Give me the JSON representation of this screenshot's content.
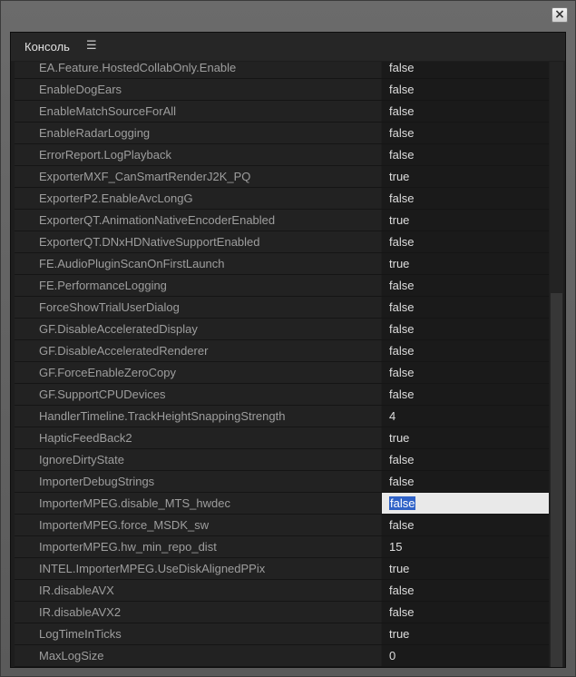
{
  "window": {
    "close_label": "×"
  },
  "panel": {
    "title": "Консоль",
    "menu_icon": "☰"
  },
  "rows": [
    {
      "key": "EA.Feature.HostedCollabOnly.Enable",
      "value": "false"
    },
    {
      "key": "EnableDogEars",
      "value": "false"
    },
    {
      "key": "EnableMatchSourceForAll",
      "value": "false"
    },
    {
      "key": "EnableRadarLogging",
      "value": "false"
    },
    {
      "key": "ErrorReport.LogPlayback",
      "value": "false"
    },
    {
      "key": "ExporterMXF_CanSmartRenderJ2K_PQ",
      "value": "true"
    },
    {
      "key": "ExporterP2.EnableAvcLongG",
      "value": "false"
    },
    {
      "key": "ExporterQT.AnimationNativeEncoderEnabled",
      "value": "true"
    },
    {
      "key": "ExporterQT.DNxHDNativeSupportEnabled",
      "value": "false"
    },
    {
      "key": "FE.AudioPluginScanOnFirstLaunch",
      "value": "true"
    },
    {
      "key": "FE.PerformanceLogging",
      "value": "false"
    },
    {
      "key": "ForceShowTrialUserDialog",
      "value": "false"
    },
    {
      "key": "GF.DisableAcceleratedDisplay",
      "value": "false"
    },
    {
      "key": "GF.DisableAcceleratedRenderer",
      "value": "false"
    },
    {
      "key": "GF.ForceEnableZeroCopy",
      "value": "false"
    },
    {
      "key": "GF.SupportCPUDevices",
      "value": "false"
    },
    {
      "key": "HandlerTimeline.TrackHeightSnappingStrength",
      "value": "4"
    },
    {
      "key": "HapticFeedBack2",
      "value": "true"
    },
    {
      "key": "IgnoreDirtyState",
      "value": "false"
    },
    {
      "key": "ImporterDebugStrings",
      "value": "false"
    },
    {
      "key": "ImporterMPEG.disable_MTS_hwdec",
      "value": "false",
      "selected": true
    },
    {
      "key": "ImporterMPEG.force_MSDK_sw",
      "value": "false"
    },
    {
      "key": "ImporterMPEG.hw_min_repo_dist",
      "value": "15"
    },
    {
      "key": "INTEL.ImporterMPEG.UseDiskAlignedPPix",
      "value": "true"
    },
    {
      "key": "IR.disableAVX",
      "value": "false"
    },
    {
      "key": "IR.disableAVX2",
      "value": "false"
    },
    {
      "key": "LogTimeInTicks",
      "value": "true"
    },
    {
      "key": "MaxLogSize",
      "value": "0"
    }
  ]
}
